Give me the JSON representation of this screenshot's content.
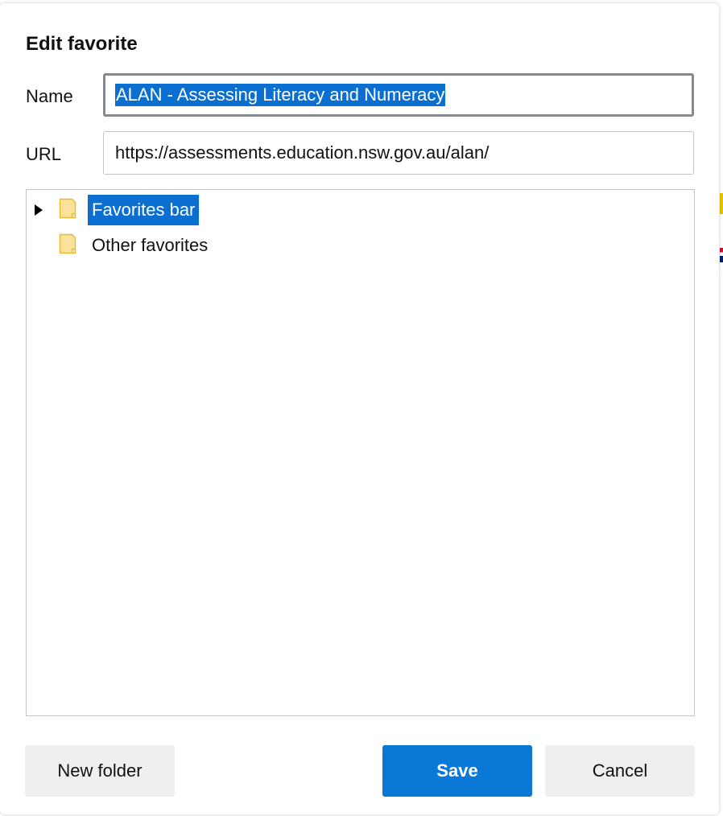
{
  "dialog": {
    "title": "Edit favorite",
    "name_label": "Name",
    "name_value": "ALAN - Assessing Literacy and Numeracy",
    "url_label": "URL",
    "url_value": "https://assessments.education.nsw.gov.au/alan/"
  },
  "tree": {
    "items": [
      {
        "label": "Favorites bar",
        "icon": "folder-icon",
        "expandable": true,
        "selected": true
      },
      {
        "label": "Other favorites",
        "icon": "folder-icon",
        "expandable": false,
        "selected": false
      }
    ]
  },
  "buttons": {
    "new_folder": "New folder",
    "save": "Save",
    "cancel": "Cancel"
  },
  "colors": {
    "accent": "#0a78d7",
    "selection": "#0a6fd1",
    "folder_fill": "#fbe29a",
    "folder_stroke": "#e8b931"
  }
}
